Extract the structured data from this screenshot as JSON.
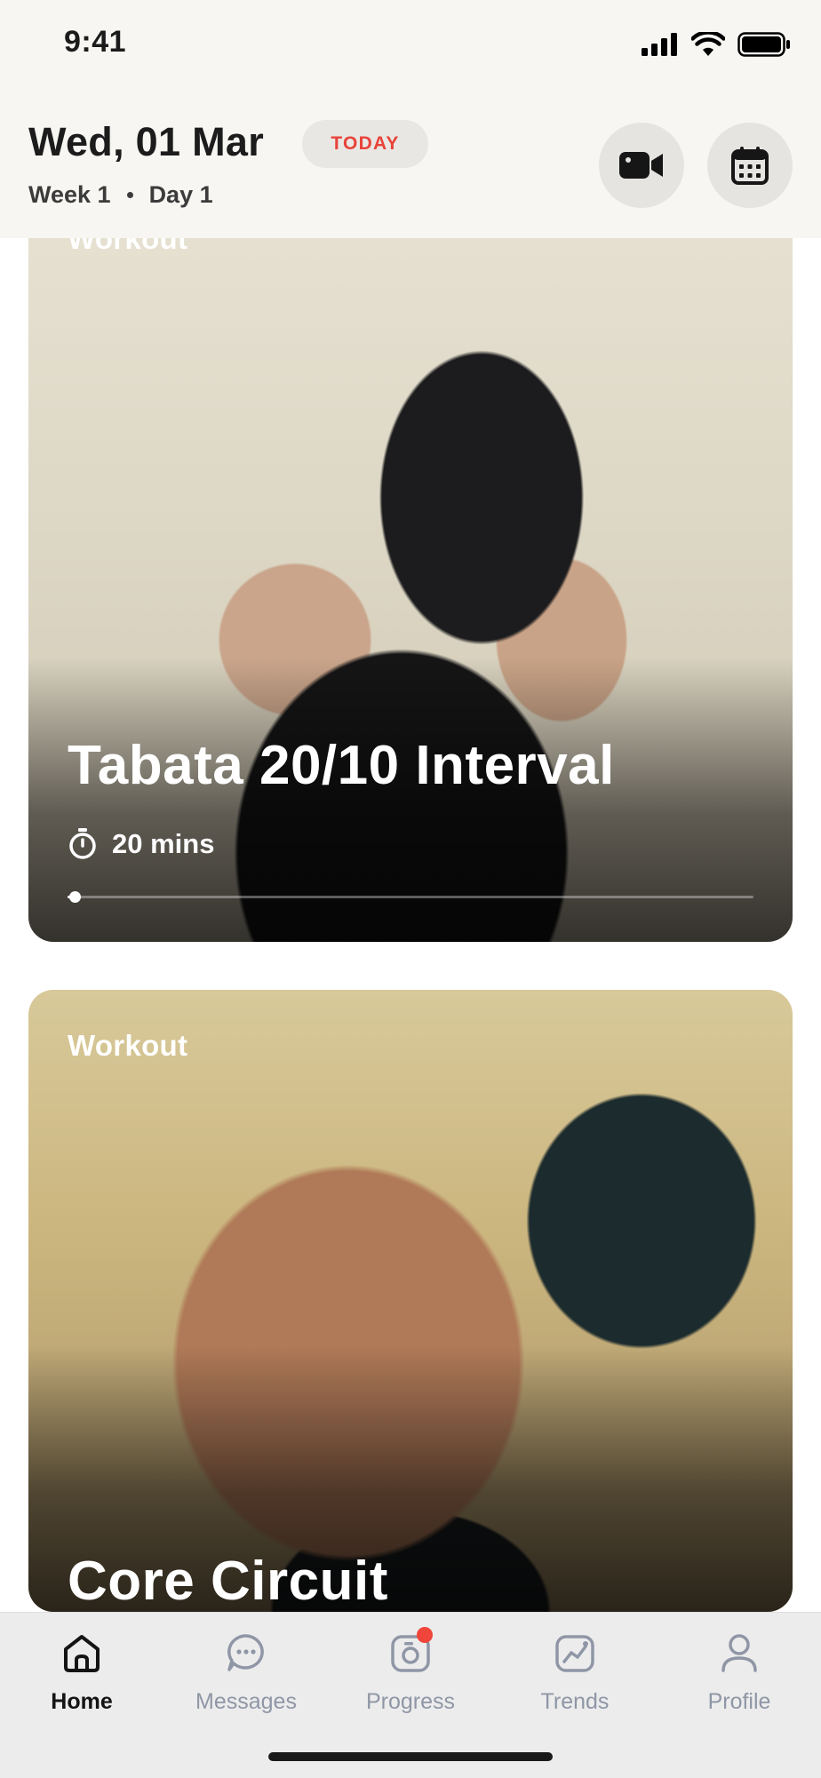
{
  "status_bar": {
    "time": "9:41"
  },
  "header": {
    "date": "Wed, 01 Mar",
    "badge": "TODAY",
    "week": "Week 1",
    "day": "Day 1",
    "actions": [
      {
        "icon": "video-camera-icon"
      },
      {
        "icon": "calendar-icon"
      }
    ]
  },
  "workouts": [
    {
      "kicker": "Workout",
      "title": "Tabata 20/10 Interval",
      "duration": "20 mins",
      "progress": 0.01
    },
    {
      "kicker": "Workout",
      "title": "Core Circuit"
    }
  ],
  "tab_bar": {
    "active": "Home",
    "tabs": [
      {
        "label": "Home",
        "icon": "home-icon"
      },
      {
        "label": "Messages",
        "icon": "chat-bubble-icon"
      },
      {
        "label": "Progress",
        "icon": "camera-icon",
        "has_notification": true
      },
      {
        "label": "Trends",
        "icon": "trend-chart-icon"
      },
      {
        "label": "Profile",
        "icon": "person-icon"
      }
    ]
  },
  "colors": {
    "accent": "#e8433a",
    "notification": "#f0453a",
    "tab_inactive": "#8f96a6",
    "tab_active": "#141414"
  }
}
